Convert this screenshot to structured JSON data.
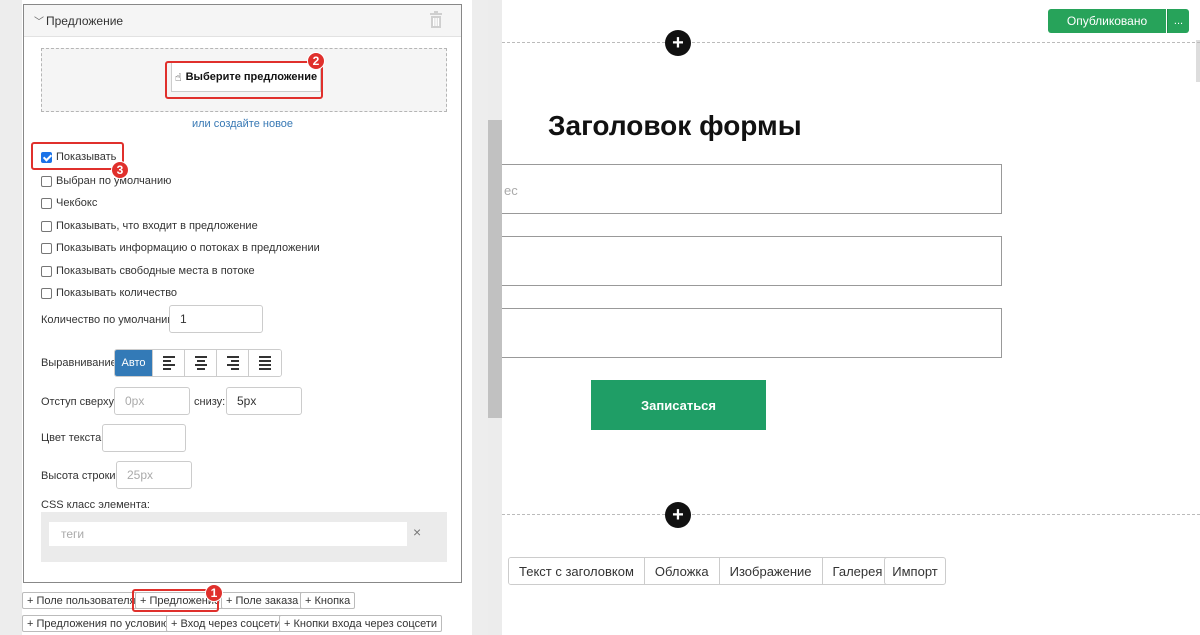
{
  "editor": {
    "block_title": "Предложение",
    "select_offer_label": "Выберите предложение",
    "create_new_link": "или создайте новое",
    "checkboxes": [
      {
        "label": "Показывать",
        "checked": true
      },
      {
        "label": "Выбран по умолчанию",
        "checked": false
      },
      {
        "label": "Чекбокс",
        "checked": false
      },
      {
        "label": "Показывать, что входит в предложение",
        "checked": false
      },
      {
        "label": "Показывать информацию о потоках в предложении",
        "checked": false
      },
      {
        "label": "Показывать свободные места в потоке",
        "checked": false
      },
      {
        "label": "Показывать количество",
        "checked": false
      }
    ],
    "default_qty_label": "Количество по умолчанию",
    "default_qty_value": "1",
    "align_label": "Выравнивание",
    "align_auto": "Авто",
    "top_margin_label": "Отступ сверху:",
    "top_margin_placeholder": "0px",
    "bottom_margin_label": "снизу:",
    "bottom_margin_value": "5px",
    "text_color_label": "Цвет текста:",
    "line_height_label": "Высота строки:",
    "line_height_placeholder": "25px",
    "css_class_label": "CSS класс элемента:",
    "tags_placeholder": "теги",
    "tags_clear": "×",
    "add_buttons_row1": [
      "+ Поле пользователя",
      "+ Предложение",
      "+ Поле заказа",
      "+ Кнопка"
    ],
    "add_buttons_row2": [
      "+ Предложения по условию",
      "+ Вход через соцсети",
      "+ Кнопки входа через соцсети"
    ]
  },
  "preview": {
    "published_label": "Опубликовано",
    "more_label": "...",
    "add_block_icon": "+",
    "form_title": "Заголовок формы",
    "input1_fragment": "ес",
    "submit_label": "Записаться",
    "tabs": [
      "Текст с заголовком",
      "Обложка",
      "Изображение",
      "Галерея"
    ],
    "import_label": "Импорт"
  },
  "annotations": {
    "markers": [
      "1",
      "2",
      "3"
    ],
    "color": "#e0302c"
  },
  "colors": {
    "published": "#27a35a",
    "submit": "#1f9e66",
    "link": "#3778b4",
    "align_active": "#337ab7"
  }
}
